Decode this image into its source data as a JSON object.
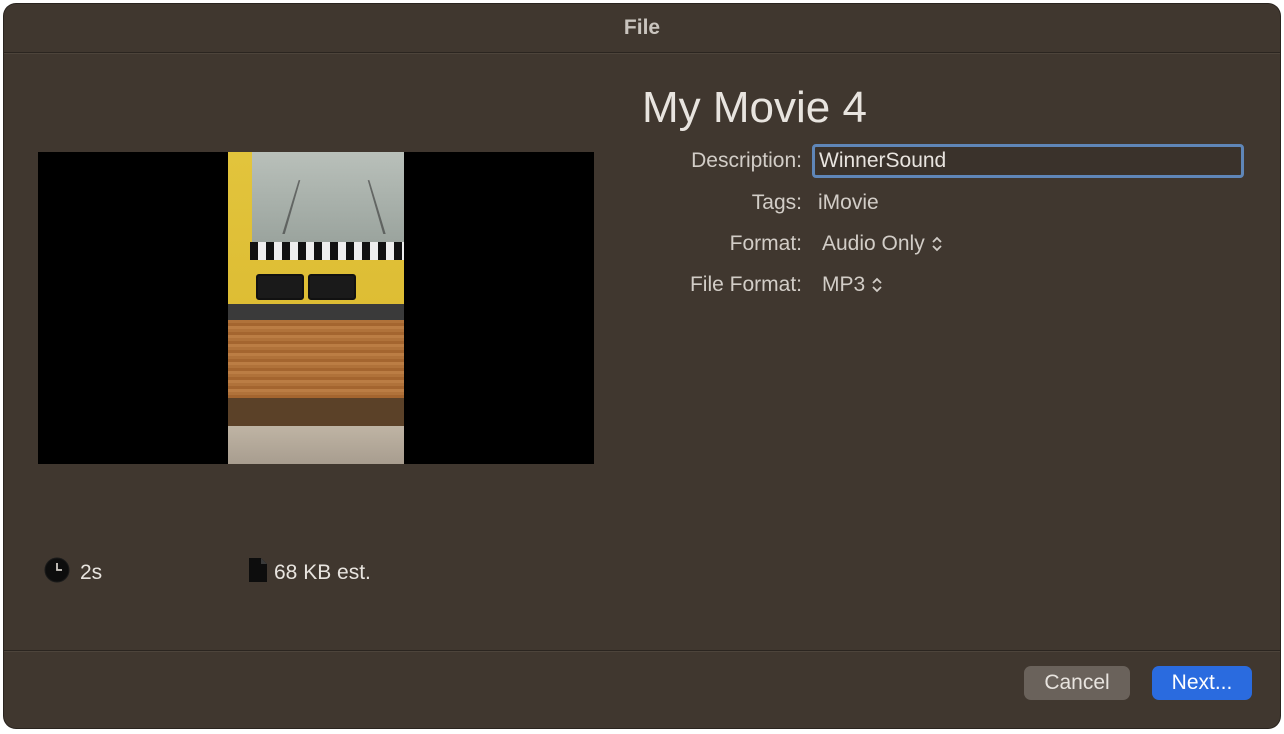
{
  "window": {
    "title": "File"
  },
  "movie": {
    "title": "My Movie 4"
  },
  "form": {
    "description": {
      "label": "Description:",
      "value": "WinnerSound"
    },
    "tags": {
      "label": "Tags:",
      "value": "iMovie"
    },
    "format": {
      "label": "Format:",
      "value": "Audio Only"
    },
    "file_format": {
      "label": "File Format:",
      "value": "MP3"
    }
  },
  "info": {
    "duration": "2s",
    "size": "68 KB est."
  },
  "buttons": {
    "cancel": "Cancel",
    "next": "Next..."
  },
  "icons": {
    "duration": "clock-icon",
    "size": "document-icon",
    "stepper": "up-down-chevron-icon"
  },
  "colors": {
    "window_bg": "#40372f",
    "accent": "#2a6bdf",
    "focus_ring": "#5f86b8"
  }
}
